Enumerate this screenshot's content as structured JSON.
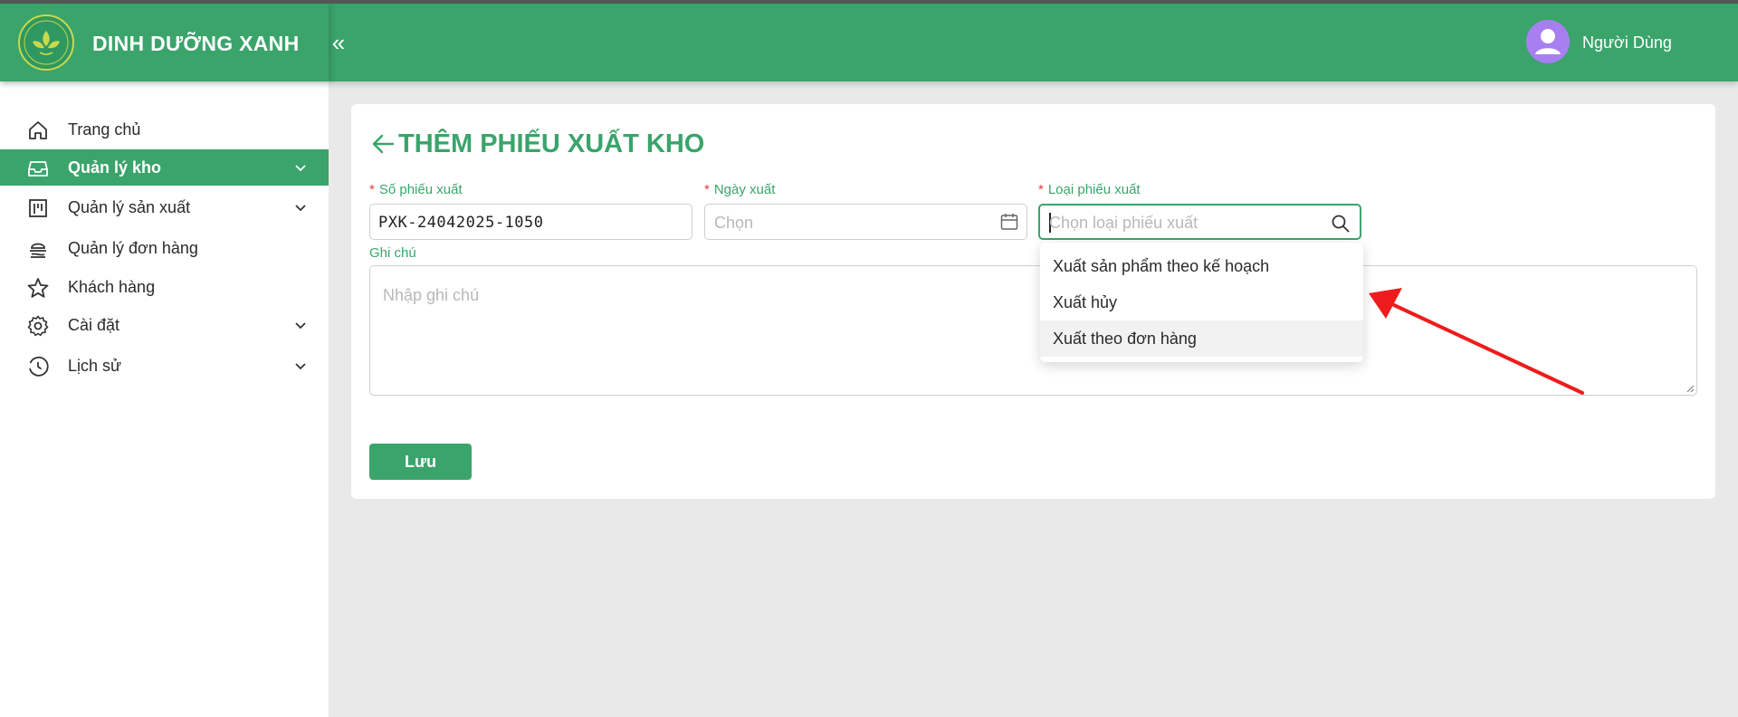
{
  "app": {
    "brand_name": "DINH DƯỠNG XANH",
    "collapse_icon": "«"
  },
  "user": {
    "name": "Người Dùng"
  },
  "sidebar": {
    "items": [
      {
        "label": "Trang chủ",
        "icon": "home-icon"
      },
      {
        "label": "Quản lý kho",
        "icon": "inbox-icon",
        "active": true
      },
      {
        "label": "Quản lý sản xuất",
        "icon": "production-icon"
      },
      {
        "label": "Quản lý đơn hàng",
        "icon": "order-icon"
      },
      {
        "label": "Khách hàng",
        "icon": "star-icon"
      },
      {
        "label": "Cài đặt",
        "icon": "gear-icon"
      },
      {
        "label": "Lịch sử",
        "icon": "history-icon"
      }
    ]
  },
  "form": {
    "title": "THÊM PHIẾU XUẤT KHO",
    "receipt_number": {
      "label": "Số phiếu xuất",
      "value": "PXK-24042025-1050"
    },
    "export_date": {
      "label": "Ngày xuất",
      "placeholder": "Chọn"
    },
    "export_type": {
      "label": "Loại phiếu xuất",
      "placeholder": "Chọn loại phiếu xuất",
      "options": [
        "Xuất sản phẩm theo kế hoạch",
        "Xuất hủy",
        "Xuất theo đơn hàng"
      ]
    },
    "note": {
      "label": "Ghi chú",
      "placeholder": "Nhập ghi chú"
    },
    "save_label": "Lưu"
  },
  "colors": {
    "primary": "#3aa46b",
    "required": "#e5393c",
    "annotation": "#ee1c1c",
    "avatar": "#a77ff1"
  }
}
